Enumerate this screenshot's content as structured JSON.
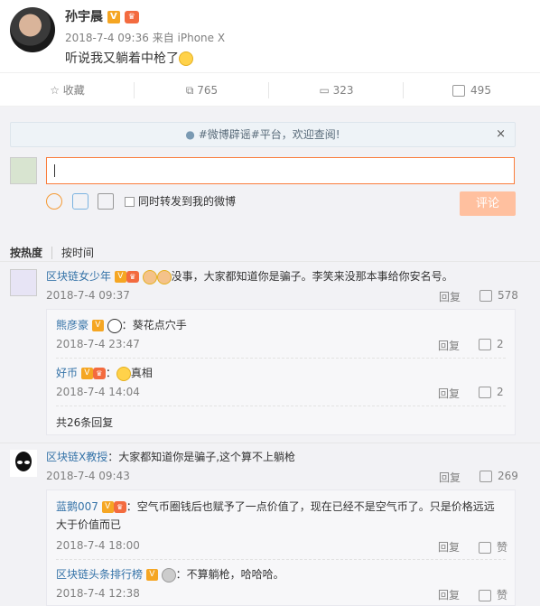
{
  "post": {
    "author": "孙宇晨",
    "time": "2018-7-4 09:36",
    "source": "来自 iPhone X",
    "text": "听说我又躺着中枪了"
  },
  "actions": {
    "favorite": "收藏",
    "forward": "765",
    "comment": "323",
    "like": "495"
  },
  "notice": "#微博辟谣#平台，欢迎查阅!",
  "composer": {
    "forward_label": "同时转发到我的微博",
    "submit_label": "评论"
  },
  "sort": {
    "hot": "按热度",
    "time": "按时间"
  },
  "comments": [
    {
      "user": "区块链女少年",
      "text": "没事，大家都知道你是骗子。李笑来没那本事给你安名号。",
      "time": "2018-7-4 09:37",
      "reply": "回复",
      "likes": "578",
      "replies": [
        {
          "user": "熊彦豪",
          "text": "葵花点穴手",
          "time": "2018-7-4 23:47",
          "reply": "回复",
          "likes": "2"
        },
        {
          "user": "好币",
          "text": "真相",
          "time": "2018-7-4 14:04",
          "reply": "回复",
          "likes": "2"
        }
      ],
      "more": "共26条回复"
    },
    {
      "user": "区块链X教授",
      "text": "：大家都知道你是骗子,这个算不上躺枪",
      "time": "2018-7-4 09:43",
      "reply": "回复",
      "likes": "269",
      "replies": [
        {
          "user": "蓝鹅007",
          "text": "：空气币圈钱后也赋予了一点价值了，现在已经不是空气币了。只是价格远远",
          "text2": "大于价值而已",
          "time": "2018-7-4 18:00",
          "reply": "回复",
          "likes": "赞"
        },
        {
          "user": "区块链头条排行榜",
          "text": "：不算躺枪，哈哈哈。",
          "time": "2018-7-4 12:38",
          "reply": "回复",
          "likes": "赞"
        }
      ]
    }
  ],
  "colors": {
    "accent": "#eb7350",
    "link": "#3573a8",
    "submit_bg": "#ffc09f",
    "badge": "#f5a623"
  }
}
